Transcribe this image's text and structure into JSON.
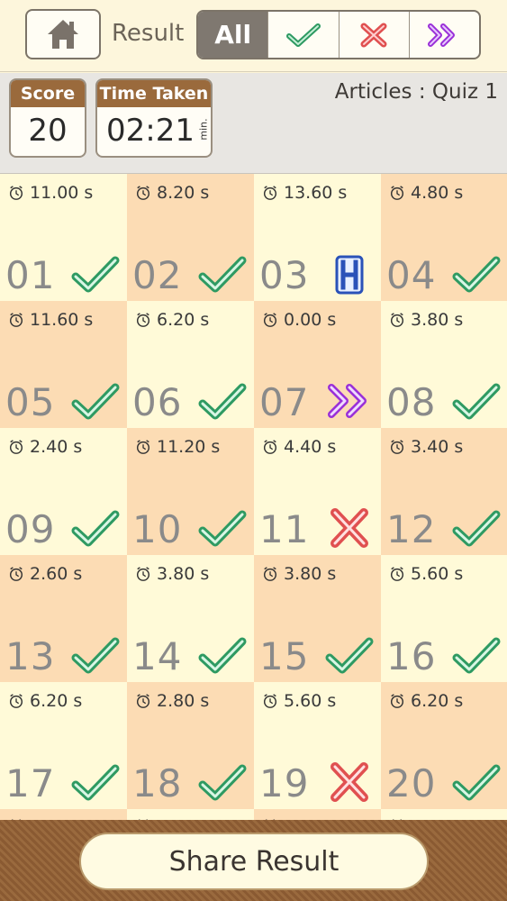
{
  "topbar": {
    "result_label": "Result",
    "filters": [
      {
        "label": "All",
        "icon": "",
        "active": true
      },
      {
        "label": "",
        "icon": "check-icon",
        "active": false
      },
      {
        "label": "",
        "icon": "cross-icon",
        "active": false
      },
      {
        "label": "",
        "icon": "skip-icon",
        "active": false
      }
    ]
  },
  "header": {
    "score_label": "Score",
    "score_value": "20",
    "time_label": "Time Taken",
    "time_value": "02:21",
    "time_unit": "min.",
    "quiz_title": "Articles : Quiz 1"
  },
  "questions": [
    {
      "num": "01",
      "time": "11.00 s",
      "status": "correct"
    },
    {
      "num": "02",
      "time": "8.20 s",
      "status": "correct"
    },
    {
      "num": "03",
      "time": "13.60 s",
      "status": "hint"
    },
    {
      "num": "04",
      "time": "4.80 s",
      "status": "correct"
    },
    {
      "num": "05",
      "time": "11.60 s",
      "status": "correct"
    },
    {
      "num": "06",
      "time": "6.20 s",
      "status": "correct"
    },
    {
      "num": "07",
      "time": "0.00 s",
      "status": "skipped"
    },
    {
      "num": "08",
      "time": "3.80 s",
      "status": "correct"
    },
    {
      "num": "09",
      "time": "2.40 s",
      "status": "correct"
    },
    {
      "num": "10",
      "time": "11.20 s",
      "status": "correct"
    },
    {
      "num": "11",
      "time": "4.40 s",
      "status": "wrong"
    },
    {
      "num": "12",
      "time": "3.40 s",
      "status": "correct"
    },
    {
      "num": "13",
      "time": "2.60 s",
      "status": "correct"
    },
    {
      "num": "14",
      "time": "3.80 s",
      "status": "correct"
    },
    {
      "num": "15",
      "time": "3.80 s",
      "status": "correct"
    },
    {
      "num": "16",
      "time": "5.60 s",
      "status": "correct"
    },
    {
      "num": "17",
      "time": "6.20 s",
      "status": "correct"
    },
    {
      "num": "18",
      "time": "2.80 s",
      "status": "correct"
    },
    {
      "num": "19",
      "time": "5.60 s",
      "status": "wrong"
    },
    {
      "num": "20",
      "time": "6.20 s",
      "status": "correct"
    }
  ],
  "footer": {
    "share_label": "Share Result"
  },
  "colors": {
    "correct": "#2e9a62",
    "wrong": "#e05050",
    "skipped": "#9a30d8",
    "hint": "#2a52b8"
  }
}
